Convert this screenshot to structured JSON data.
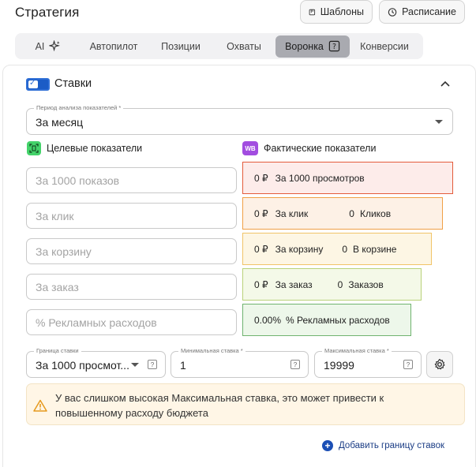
{
  "header": {
    "title": "Стратегия",
    "templates_label": "Шаблоны",
    "schedule_label": "Расписание"
  },
  "tabs": [
    {
      "label": "AI"
    },
    {
      "label": "Автопилот"
    },
    {
      "label": "Позиции"
    },
    {
      "label": "Охваты"
    },
    {
      "label": "Воронка",
      "active": true
    },
    {
      "label": "Конверсии"
    }
  ],
  "rates": {
    "title": "Ставки",
    "enabled": true,
    "period": {
      "label": "Период анализа показателей *",
      "value": "За месяц"
    },
    "target_title": "Целевые показатели",
    "actual_title": "Фактические показатели",
    "wb_badge": "WB",
    "target_placeholders": [
      "За 1000 показов",
      "За клик",
      "За корзину",
      "За заказ",
      "% Рекламных расходов"
    ],
    "actual": [
      {
        "value": "0 ₽",
        "label": "За 1000 просмотров",
        "color": "#e35b3b"
      },
      {
        "value": "0 ₽",
        "label": "За клик",
        "extra_value": "0",
        "extra_label": "Кликов",
        "color": "#f0a046"
      },
      {
        "value": "0 ₽",
        "label": "За корзину",
        "extra_value": "0",
        "extra_label": "В корзине",
        "color": "#f1c468"
      },
      {
        "value": "0 ₽",
        "label": "За заказ",
        "extra_value": "0",
        "extra_label": "Заказов",
        "color": "#b9d27a"
      },
      {
        "value": "0.00%",
        "label": "% Рекламных расходов",
        "color": "#6fb36f"
      }
    ],
    "bound": {
      "label": "Граница ставки",
      "value": "За 1000 просмот..."
    },
    "min_bid": {
      "label": "Минимальная ставка *",
      "value": "1"
    },
    "max_bid": {
      "label": "Максимальная ставка *",
      "value": "19999"
    },
    "help_glyph": "?",
    "warning": "У вас слишком высокая Максимальная ставка, это может привести к повышенному расходу бюджета",
    "add_bound_label": "Добавить границу ставок"
  }
}
